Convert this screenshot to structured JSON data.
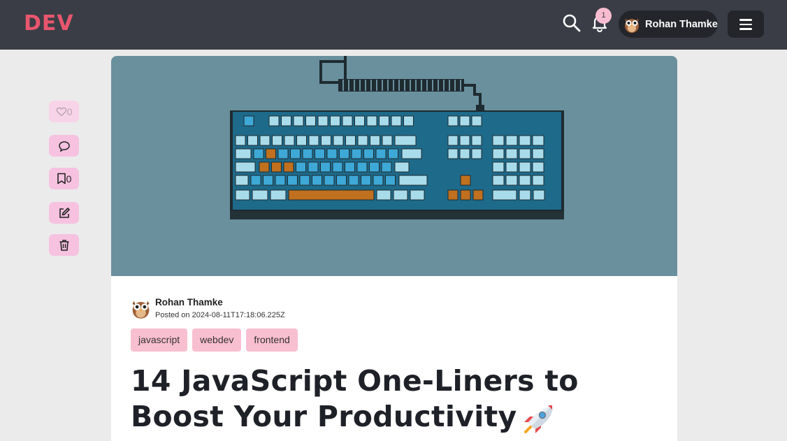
{
  "header": {
    "logo": "DEV",
    "notification_count": "1",
    "user_name": "Rohan Thamke"
  },
  "sidebar": {
    "like_count": "0",
    "bookmark_count": "0"
  },
  "article": {
    "author": "Rohan Thamke",
    "posted": "Posted on 2024-08-11T17:18:06.225Z",
    "tags": [
      "javascript",
      "webdev",
      "frontend"
    ],
    "title_line1": "14 JavaScript One-Liners to",
    "title_line2": "Boost Your Productivity"
  },
  "colors": {
    "topbar": "#3a3d45",
    "logo": "#e8566e",
    "tag_bg": "#f8bfd0",
    "side_btn": "#f6c2e0",
    "cover_bg": "#6a909e"
  }
}
